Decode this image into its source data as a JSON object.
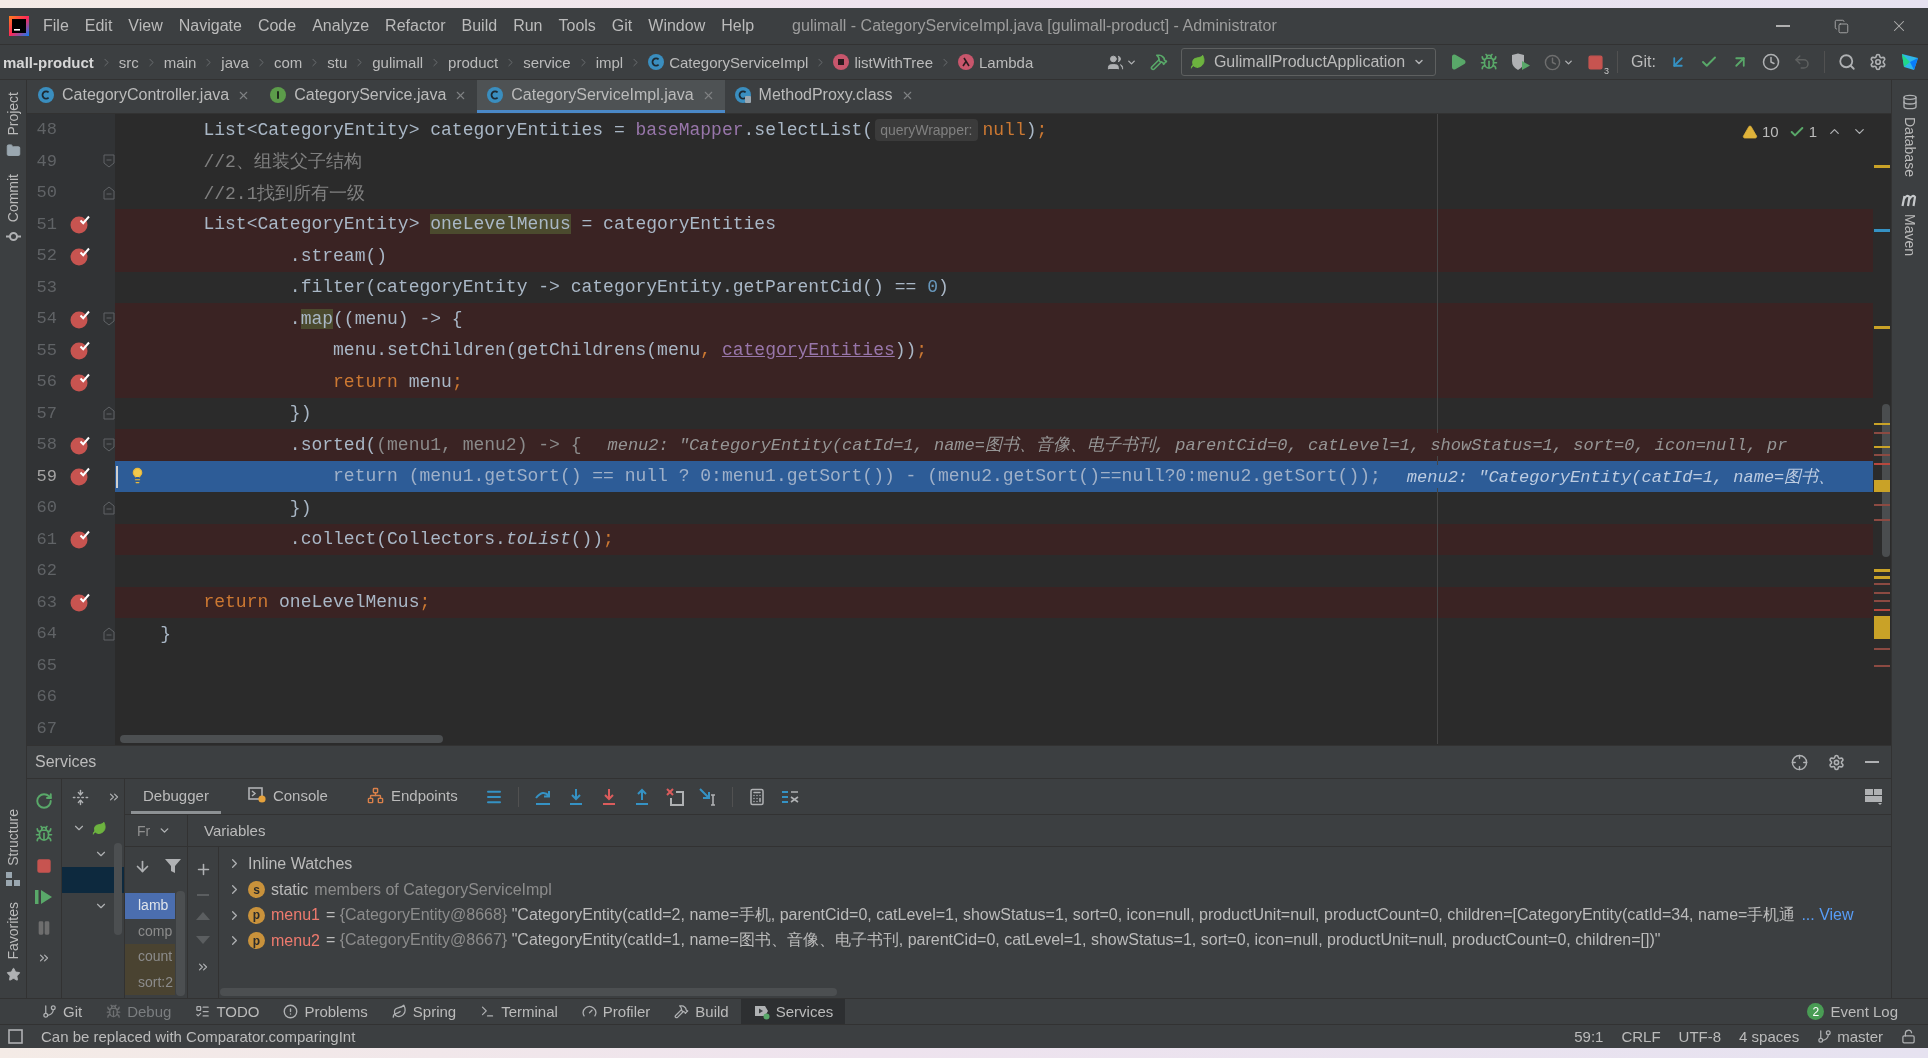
{
  "window": {
    "title": "gulimall - CategoryServiceImpl.java [gulimall-product] - Administrator"
  },
  "menu": [
    "File",
    "Edit",
    "View",
    "Navigate",
    "Code",
    "Analyze",
    "Refactor",
    "Build",
    "Run",
    "Tools",
    "Git",
    "Window",
    "Help"
  ],
  "breadcrumbs": [
    {
      "label": "mall-product",
      "kind": "module"
    },
    {
      "label": "src",
      "kind": "folder"
    },
    {
      "label": "main",
      "kind": "folder"
    },
    {
      "label": "java",
      "kind": "folder"
    },
    {
      "label": "com",
      "kind": "folder"
    },
    {
      "label": "stu",
      "kind": "folder"
    },
    {
      "label": "gulimall",
      "kind": "folder"
    },
    {
      "label": "product",
      "kind": "folder"
    },
    {
      "label": "service",
      "kind": "folder"
    },
    {
      "label": "impl",
      "kind": "folder"
    },
    {
      "label": "CategoryServiceImpl",
      "kind": "class"
    },
    {
      "label": "listWithTree",
      "kind": "method"
    },
    {
      "label": "Lambda",
      "kind": "lambda"
    }
  ],
  "toolbar": {
    "run_configuration": "GulimallProductApplication",
    "stop_badge": "3",
    "git_label": "Git:"
  },
  "left_tool_windows": {
    "top": [
      {
        "label": "Project",
        "kind": "project"
      },
      {
        "label": "Commit",
        "kind": "commit"
      }
    ],
    "bottom": [
      {
        "label": "Structure",
        "kind": "structure"
      },
      {
        "label": "Favorites",
        "kind": "favorites"
      }
    ]
  },
  "right_tool_windows": [
    {
      "label": "Database",
      "kind": "database"
    },
    {
      "label": "Maven",
      "kind": "maven"
    }
  ],
  "editor_tabs": [
    {
      "label": "CategoryController.java",
      "kind": "class",
      "selected": false
    },
    {
      "label": "CategoryService.java",
      "kind": "interface",
      "selected": false
    },
    {
      "label": "CategoryServiceImpl.java",
      "kind": "class",
      "selected": true
    },
    {
      "label": "MethodProxy.class",
      "kind": "compiled",
      "selected": false
    }
  ],
  "inspections": {
    "warnings": "10",
    "passed": "1"
  },
  "code_lines": [
    {
      "number": "48",
      "kind": "plain",
      "breakpoint": false,
      "current": false,
      "tokens": [
        {
          "kind": "plain",
          "text": "        List<CategoryEntity> categoryEntities = "
        },
        {
          "kind": "field",
          "text": "baseMapper"
        },
        {
          "kind": "plain",
          "text": ".selectList("
        },
        {
          "kind": "hint",
          "text": "queryWrapper:"
        },
        {
          "kind": "keyword",
          "text": "null"
        },
        {
          "kind": "plain",
          "text": ")"
        },
        {
          "kind": "punct",
          "text": ";"
        }
      ]
    },
    {
      "number": "49",
      "kind": "opening",
      "breakpoint": false,
      "current": false,
      "tokens": [
        {
          "kind": "comment",
          "text": "        //2、组装父子结构"
        }
      ]
    },
    {
      "number": "50",
      "kind": "closing",
      "breakpoint": false,
      "current": false,
      "tokens": [
        {
          "kind": "comment",
          "text": "        //2.1找到所有一级"
        }
      ]
    },
    {
      "number": "51",
      "kind": "plain",
      "breakpoint": true,
      "current": false,
      "tokens": [
        {
          "kind": "plain",
          "text": "        List<CategoryEntity> "
        },
        {
          "kind": "usage",
          "text": "oneLevelMenus"
        },
        {
          "kind": "plain",
          "text": " = categoryEntities"
        }
      ]
    },
    {
      "number": "52",
      "kind": "plain",
      "breakpoint": true,
      "current": false,
      "tokens": [
        {
          "kind": "plain",
          "text": "                .stream()"
        }
      ]
    },
    {
      "number": "53",
      "kind": "plain",
      "breakpoint": false,
      "current": false,
      "tokens": [
        {
          "kind": "plain",
          "text": "                .filter(categoryEntity -> categoryEntity.getParentCid() == "
        },
        {
          "kind": "number",
          "text": "0"
        },
        {
          "kind": "plain",
          "text": ")"
        }
      ]
    },
    {
      "number": "54",
      "kind": "opening",
      "breakpoint": true,
      "current": false,
      "tokens": [
        {
          "kind": "plain",
          "text": "                ."
        },
        {
          "kind": "usage",
          "text": "map"
        },
        {
          "kind": "plain",
          "text": "((menu) -> {"
        }
      ]
    },
    {
      "number": "55",
      "kind": "plain",
      "breakpoint": true,
      "current": false,
      "tokens": [
        {
          "kind": "plain",
          "text": "                    menu.setChildren(getChildrens(menu"
        },
        {
          "kind": "punct",
          "text": ", "
        },
        {
          "kind": "captured",
          "text": "categoryEntities"
        },
        {
          "kind": "plain",
          "text": "))"
        },
        {
          "kind": "punct",
          "text": ";"
        }
      ]
    },
    {
      "number": "56",
      "kind": "plain",
      "breakpoint": true,
      "current": false,
      "tokens": [
        {
          "kind": "keyword",
          "text": "                    return"
        },
        {
          "kind": "plain",
          "text": " menu"
        },
        {
          "kind": "punct",
          "text": ";"
        }
      ]
    },
    {
      "number": "57",
      "kind": "closing",
      "breakpoint": false,
      "current": false,
      "tokens": [
        {
          "kind": "plain",
          "text": "                })"
        }
      ]
    },
    {
      "number": "58",
      "kind": "opening",
      "breakpoint": true,
      "current": false,
      "tokens": [
        {
          "kind": "plain",
          "text": "                .sorted("
        },
        {
          "kind": "dim",
          "text": "(menu1, menu2) -> {"
        },
        {
          "kind": "inline",
          "text": "menu2: \"CategoryEntity(catId=1, name=图书、音像、电子书刊, parentCid=0, catLevel=1, showStatus=1, sort=0, icon=null, pr"
        }
      ]
    },
    {
      "number": "59",
      "kind": "plain",
      "breakpoint": true,
      "current": true,
      "tokens": [
        {
          "kind": "dim",
          "text": "                    return (menu1.getSort() == null ? 0:menu1.getSort()) - (menu2.getSort()==null?0:menu2.getSort());"
        },
        {
          "kind": "inline",
          "text": "menu2: \"CategoryEntity(catId=1, name=图书、"
        }
      ]
    },
    {
      "number": "60",
      "kind": "closing",
      "breakpoint": false,
      "current": false,
      "tokens": [
        {
          "kind": "plain",
          "text": "                })"
        }
      ]
    },
    {
      "number": "61",
      "kind": "plain",
      "breakpoint": true,
      "current": false,
      "tokens": [
        {
          "kind": "plain",
          "text": "                .collect(Collectors."
        },
        {
          "kind": "static",
          "text": "toList"
        },
        {
          "kind": "plain",
          "text": "())"
        },
        {
          "kind": "punct",
          "text": ";"
        }
      ]
    },
    {
      "number": "62",
      "kind": "plain",
      "breakpoint": false,
      "current": false
    },
    {
      "number": "63",
      "kind": "plain",
      "breakpoint": true,
      "current": false,
      "tokens": [
        {
          "kind": "keyword",
          "text": "        return"
        },
        {
          "kind": "plain",
          "text": " oneLevelMenus"
        },
        {
          "kind": "punct",
          "text": ";"
        }
      ]
    },
    {
      "number": "64",
      "kind": "closing",
      "breakpoint": false,
      "current": false,
      "tokens": [
        {
          "kind": "plain",
          "text": "    }"
        }
      ]
    },
    {
      "number": "65",
      "kind": "plain",
      "breakpoint": false,
      "current": false
    },
    {
      "number": "66",
      "kind": "plain",
      "breakpoint": false,
      "current": false
    },
    {
      "number": "67",
      "kind": "plain",
      "breakpoint": false,
      "current": false
    }
  ],
  "services": {
    "title": "Services",
    "tree": [
      {
        "kind": "spring-boot",
        "expanded": true,
        "selected": false,
        "children": [
          {
            "expanded": true,
            "selected": false,
            "children": [
              {
                "selected": true
              }
            ]
          },
          {
            "expanded": true,
            "selected": false
          }
        ]
      }
    ],
    "debugger_tabs": [
      {
        "label": "Debugger",
        "kind": "debugger",
        "selected": true
      },
      {
        "label": "Console",
        "kind": "console",
        "selected": false
      },
      {
        "label": "Endpoints",
        "kind": "endpoints",
        "selected": false
      }
    ],
    "frames": {
      "header": "Fr",
      "items": [
        {
          "label": "lamb",
          "selected": true,
          "library": false
        },
        {
          "label": "comp",
          "selected": false,
          "library": false
        },
        {
          "label": "count",
          "selected": false,
          "library": true
        },
        {
          "label": "sort:2",
          "selected": false,
          "library": true
        }
      ]
    },
    "variables_title": "Variables",
    "variables": [
      {
        "kind": "group",
        "name": "Inline Watches"
      },
      {
        "kind": "static",
        "badge": "s",
        "name": "static",
        "description": "members of CategoryServiceImpl"
      },
      {
        "kind": "field",
        "badge": "p",
        "name": "menu1",
        "operator": "=",
        "type": "{CategoryEntity@8668}",
        "value": "\"CategoryEntity(catId=2, name=手机, parentCid=0, catLevel=1, showStatus=1, sort=0, icon=null, productUnit=null, productCount=0, children=[CategoryEntity(catId=34, name=手机通",
        "link": "... View"
      },
      {
        "kind": "field",
        "badge": "p",
        "name": "menu2",
        "operator": "=",
        "type": "{CategoryEntity@8667}",
        "value": "\"CategoryEntity(catId=1, name=图书、音像、电子书刊, parentCid=0, catLevel=1, showStatus=1, sort=0, icon=null, productUnit=null, productCount=0, children=[])\""
      }
    ]
  },
  "tool_window_bar": [
    {
      "label": "Git",
      "kind": "git",
      "selected": false,
      "disabled": false
    },
    {
      "label": "Debug",
      "kind": "debug",
      "selected": false,
      "disabled": true
    },
    {
      "label": "TODO",
      "kind": "todo",
      "selected": false,
      "disabled": false
    },
    {
      "label": "Problems",
      "kind": "problems",
      "selected": false,
      "disabled": false
    },
    {
      "label": "Spring",
      "kind": "spring",
      "selected": false,
      "disabled": false
    },
    {
      "label": "Terminal",
      "kind": "terminal",
      "selected": false,
      "disabled": false
    },
    {
      "label": "Profiler",
      "kind": "profiler",
      "selected": false,
      "disabled": false
    },
    {
      "label": "Build",
      "kind": "build",
      "selected": false,
      "disabled": false
    },
    {
      "label": "Services",
      "kind": "services",
      "selected": true,
      "disabled": false
    }
  ],
  "event_log": {
    "count": "2",
    "label": "Event Log"
  },
  "status_bar": {
    "message": "Can be replaced with Comparator.comparingInt",
    "position": "59:1",
    "line_separator": "CRLF",
    "encoding": "UTF-8",
    "indent": "4 spaces",
    "branch": "master"
  }
}
